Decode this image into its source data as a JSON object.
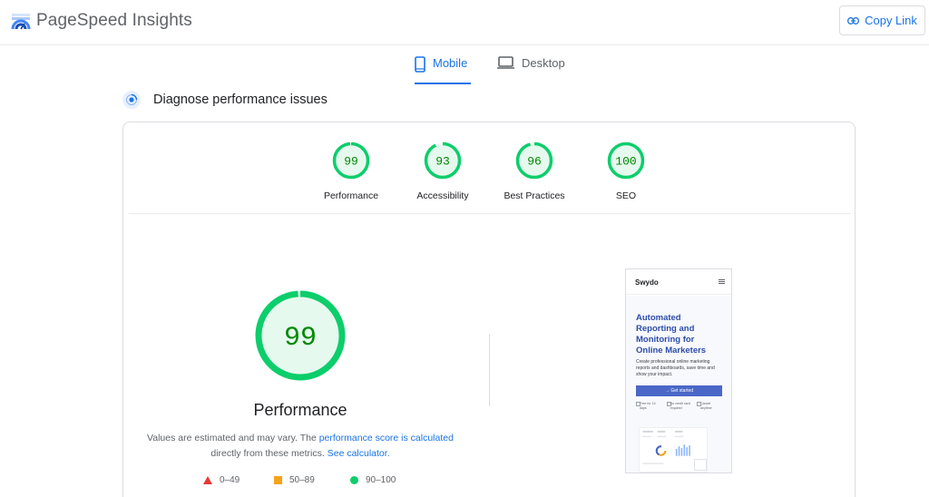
{
  "header": {
    "brand": "PageSpeed Insights",
    "copy_link": "Copy Link"
  },
  "tabs": [
    {
      "label": "Mobile",
      "icon": "phone-icon",
      "active": true
    },
    {
      "label": "Desktop",
      "icon": "laptop-icon",
      "active": false
    }
  ],
  "section": {
    "title": "Diagnose performance issues"
  },
  "scores": [
    {
      "label": "Performance",
      "value": 99,
      "display": "99"
    },
    {
      "label": "Accessibility",
      "value": 93,
      "display": "93"
    },
    {
      "label": "Best Practices",
      "value": 96,
      "display": "96"
    },
    {
      "label": "SEO",
      "value": 100,
      "display": "100"
    }
  ],
  "main_score": {
    "value": 99,
    "display": "99",
    "title": "Performance",
    "note_1": "Values are estimated and may vary. The ",
    "note_link_1": "performance score is calculated",
    "note_2": "directly from these metrics. ",
    "note_link_2": "See calculator."
  },
  "legend": [
    {
      "label": "0–49",
      "shape": "triangle",
      "color": "#e53935"
    },
    {
      "label": "50–89",
      "shape": "square",
      "color": "#f4a31b"
    },
    {
      "label": "90–100",
      "shape": "circle",
      "color": "#0cce6b"
    }
  ],
  "screenshot": {
    "brand": "Swydo",
    "headline": "Automated Reporting and Monitoring for Online Marketers",
    "subtext": "Create professional online marketing reports and dashboards, save time and show your impact.",
    "button": "→ Get started",
    "features": [
      "Free for 14 days",
      "No credit card required",
      "Cancel anytime"
    ]
  },
  "colors": {
    "good": "#0cce6b",
    "good_text": "#008800",
    "good_fill": "#e6f9ee",
    "accent": "#1a73e8"
  }
}
